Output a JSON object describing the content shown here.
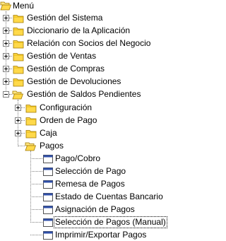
{
  "tree": {
    "root": {
      "label": "Menú",
      "icon": "folder-open-icon"
    },
    "items": [
      {
        "label": "Gestión del Sistema",
        "icon": "folder-closed-icon",
        "state": "collapsed"
      },
      {
        "label": "Diccionario de la Aplicación",
        "icon": "folder-closed-icon",
        "state": "collapsed"
      },
      {
        "label": "Relación con Socios del Negocio",
        "icon": "folder-closed-icon",
        "state": "collapsed"
      },
      {
        "label": "Gestión de Ventas",
        "icon": "folder-closed-icon",
        "state": "collapsed"
      },
      {
        "label": "Gestión de Compras",
        "icon": "folder-closed-icon",
        "state": "collapsed"
      },
      {
        "label": "Gestión de Devoluciones",
        "icon": "folder-closed-icon",
        "state": "collapsed"
      },
      {
        "label": "Gestión de Saldos Pendientes",
        "icon": "folder-open-icon",
        "state": "expanded",
        "children": [
          {
            "label": "Configuración",
            "icon": "folder-closed-icon",
            "state": "collapsed"
          },
          {
            "label": "Orden de Pago",
            "icon": "folder-closed-icon",
            "state": "collapsed"
          },
          {
            "label": "Caja",
            "icon": "folder-closed-icon",
            "state": "collapsed"
          },
          {
            "label": "Pagos",
            "icon": "folder-open-icon",
            "state": "expanded",
            "children": [
              {
                "label": "Pago/Cobro",
                "icon": "window-icon"
              },
              {
                "label": "Selección de Pago",
                "icon": "window-icon"
              },
              {
                "label": "Remesa de Pagos",
                "icon": "window-icon"
              },
              {
                "label": "Estado de Cuentas Bancario",
                "icon": "window-icon"
              },
              {
                "label": "Asignación de Pagos",
                "icon": "window-icon"
              },
              {
                "label": "Selección de Pagos (Manual)",
                "icon": "window-icon",
                "selected": true
              },
              {
                "label": "Imprimir/Exportar Pagos",
                "icon": "window-icon"
              }
            ]
          }
        ]
      }
    ]
  },
  "colors": {
    "folder_fill": "#FFD94A",
    "folder_stroke": "#A07800",
    "connector": "#808080",
    "window_title": "#2F4FA8"
  }
}
